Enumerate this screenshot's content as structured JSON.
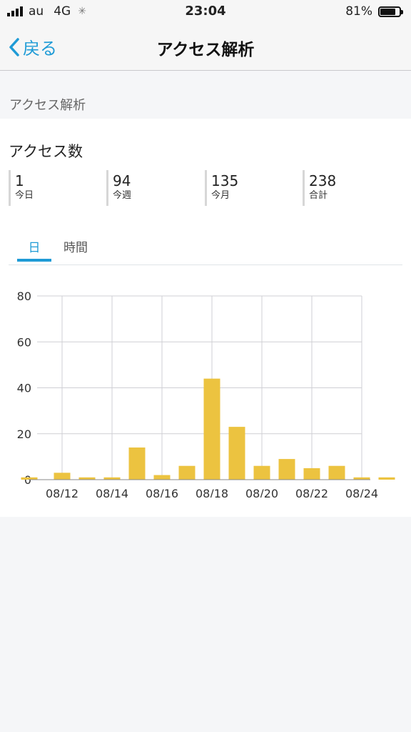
{
  "status_bar": {
    "carrier": "au",
    "network": "4G",
    "time": "23:04",
    "battery_percent": "81%",
    "battery_level": 0.81,
    "signal_bars": 4
  },
  "nav": {
    "back_label": "戻る",
    "title": "アクセス解析"
  },
  "section_label": "アクセス解析",
  "card": {
    "title": "アクセス数",
    "stats": [
      {
        "value": "1",
        "label": "今日"
      },
      {
        "value": "94",
        "label": "今週"
      },
      {
        "value": "135",
        "label": "今月"
      },
      {
        "value": "238",
        "label": "合計"
      }
    ],
    "tabs": [
      {
        "label": "日",
        "active": true
      },
      {
        "label": "時間",
        "active": false
      }
    ]
  },
  "colors": {
    "accent": "#1f9bd6",
    "bar": "#ecc340",
    "grid": "#cfcfd4"
  },
  "chart_data": {
    "type": "bar",
    "categories": [
      "08/11",
      "08/12",
      "08/13",
      "08/14",
      "08/15",
      "08/16",
      "08/17",
      "08/18",
      "08/19",
      "08/20",
      "08/21",
      "08/22",
      "08/23",
      "08/24",
      "08/25"
    ],
    "values": [
      1,
      3,
      1,
      1,
      14,
      2,
      6,
      44,
      23,
      6,
      9,
      5,
      6,
      1,
      1
    ],
    "x_tick_labels": [
      "08/12",
      "08/14",
      "08/16",
      "08/18",
      "08/20",
      "08/22",
      "08/24"
    ],
    "y_ticks": [
      0,
      20,
      40,
      60,
      80
    ],
    "ylim": [
      0,
      80
    ],
    "grid": true,
    "title": "",
    "xlabel": "",
    "ylabel": ""
  }
}
